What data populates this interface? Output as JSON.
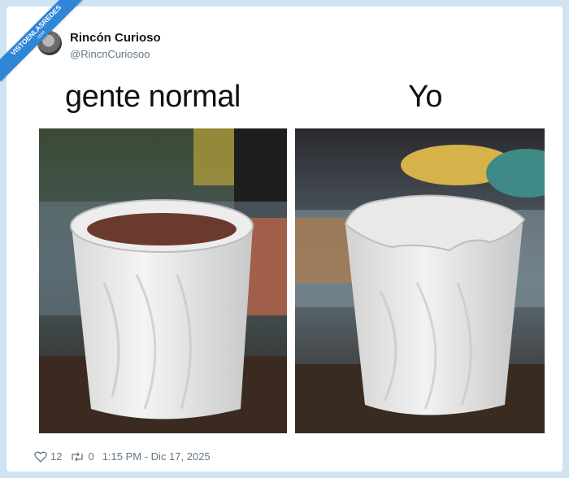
{
  "watermark": {
    "line1": "VISTOENLASREDES",
    "line2": ".com"
  },
  "tweet": {
    "display_name": "Rincón Curioso",
    "handle": "@RincnCuriosoo",
    "caption_left": "gente normal",
    "caption_right": "Yo",
    "likes": "12",
    "retweets": "0",
    "timestamp": "1:15 PM - Dic 17, 2025"
  },
  "icons": {
    "like": "heart-icon",
    "retweet": "retweet-icon"
  },
  "colors": {
    "background": "#cfe3f3",
    "ribbon": "#2f86d6",
    "text_secondary": "#657786"
  }
}
